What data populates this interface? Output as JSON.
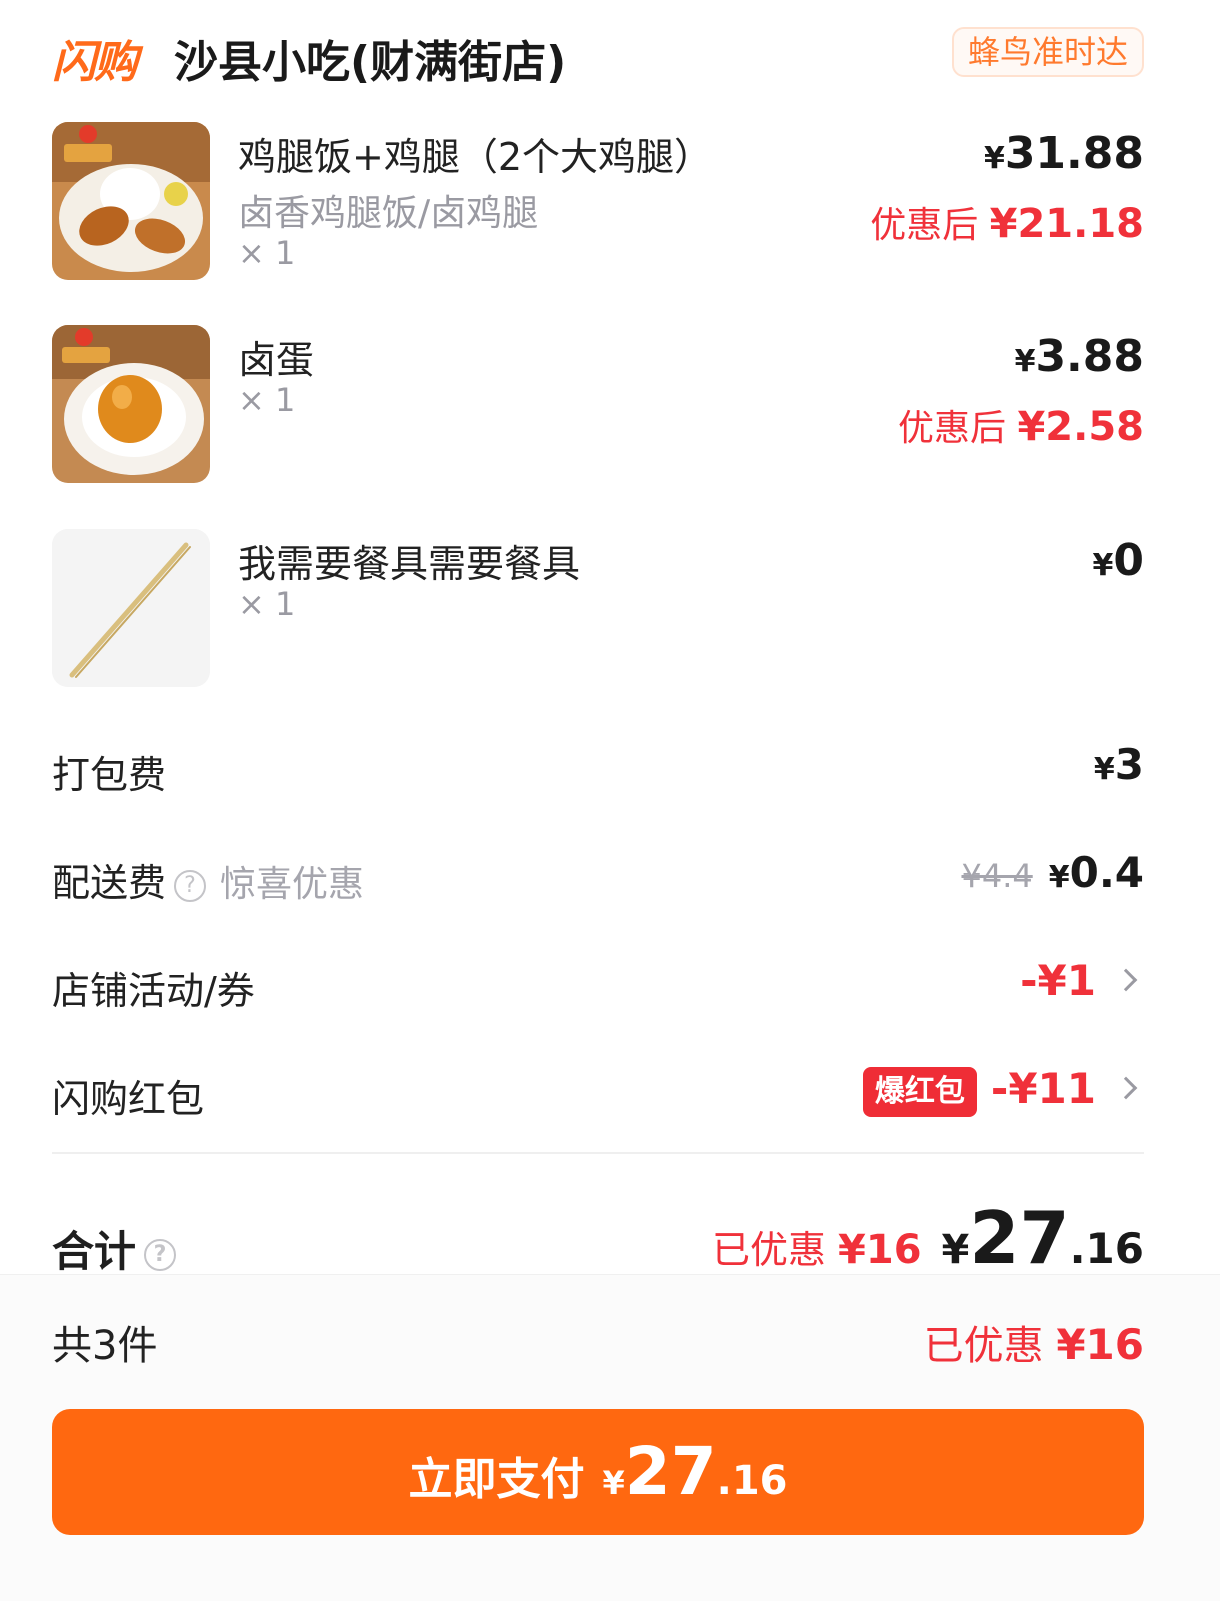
{
  "header": {
    "brand": "闪购",
    "store_name": "沙县小吃(财满街店)",
    "delivery_tag": "蜂鸟准时达"
  },
  "items": [
    {
      "name": "鸡腿饭+鸡腿（2个大鸡腿）",
      "spec": "卤香鸡腿饭/卤鸡腿",
      "qty": "× 1",
      "currency": "¥",
      "price": "31.88",
      "discount_label": "优惠后 ",
      "discount_price": "¥21.18",
      "image_icon": "chicken-leg-rice-photo"
    },
    {
      "name": "卤蛋",
      "qty": "× 1",
      "currency": "¥",
      "price": "3.88",
      "discount_label": "优惠后 ",
      "discount_price": "¥2.58",
      "image_icon": "braised-egg-photo"
    },
    {
      "name": "我需要餐具需要餐具",
      "qty": "× 1",
      "currency": "¥",
      "price": "0",
      "image_icon": "chopsticks-photo"
    }
  ],
  "fees": {
    "packing": {
      "label": "打包费",
      "currency": "¥",
      "value": "3"
    },
    "delivery": {
      "label": "配送费",
      "note": "惊喜优惠",
      "original": "¥4.4",
      "currency": "¥",
      "value": "0.4"
    },
    "store_promo": {
      "label": "店铺活动/券",
      "value": "-¥1"
    },
    "red_packet": {
      "label": "闪购红包",
      "badge": "爆红包",
      "value": "-¥11"
    }
  },
  "total": {
    "label": "合计",
    "saved_label": "已优惠 ",
    "saved_value": "¥16",
    "currency": "¥",
    "integer": "27",
    "decimal": ".16"
  },
  "bottom": {
    "count": "共3件",
    "saved_label": "已优惠 ",
    "saved_value": "¥16"
  },
  "pay_button": {
    "label": "立即支付",
    "currency": "¥",
    "integer": "27",
    "decimal": ".16"
  },
  "colors": {
    "brand_orange": "#ff6810",
    "discount_red": "#f0313a",
    "muted_gray": "#9a9aa2"
  }
}
